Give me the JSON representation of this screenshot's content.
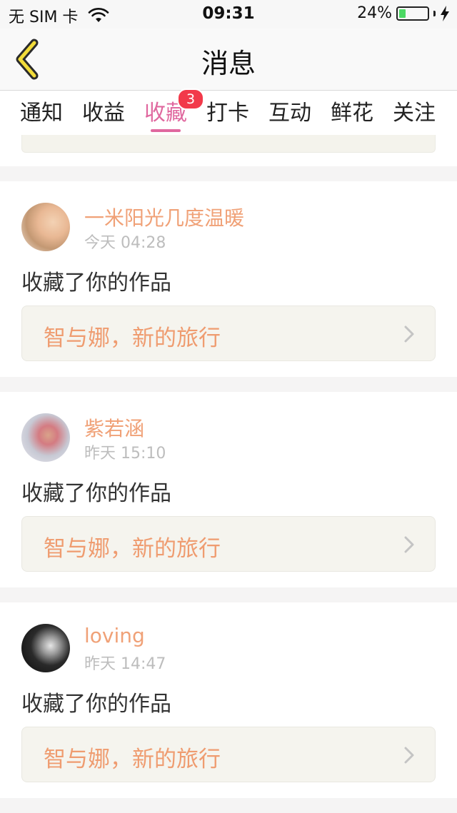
{
  "status_bar": {
    "carrier": "无 SIM 卡",
    "time": "09:31",
    "battery_text": "24%",
    "battery_level": 0.24
  },
  "nav": {
    "title": "消息"
  },
  "tabs": [
    {
      "label": "通知"
    },
    {
      "label": "收益"
    },
    {
      "label": "收藏",
      "active": true,
      "badge": "3"
    },
    {
      "label": "打卡"
    },
    {
      "label": "互动"
    },
    {
      "label": "鲜花"
    },
    {
      "label": "关注"
    }
  ],
  "colors": {
    "accent": "#e0689f",
    "username": "#f0a177",
    "work_title": "#ef9c70",
    "badge": "#f2394a"
  },
  "messages": [
    {
      "user": "一米阳光几度温暖",
      "time": "今天 04:28",
      "action": "收藏了你的作品",
      "work_title": "智与娜，新的旅行"
    },
    {
      "user": "紫若涵",
      "time": "昨天 15:10",
      "action": "收藏了你的作品",
      "work_title": "智与娜，新的旅行"
    },
    {
      "user": "loving",
      "time": "昨天 14:47",
      "action": "收藏了你的作品",
      "work_title": "智与娜，新的旅行"
    }
  ]
}
